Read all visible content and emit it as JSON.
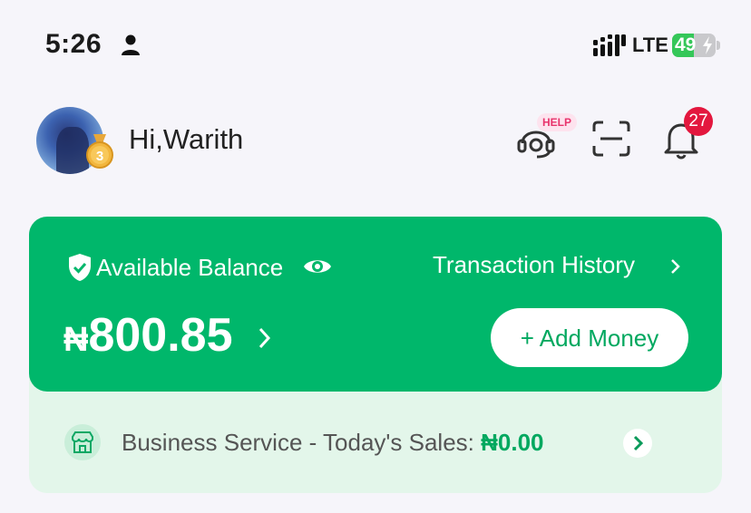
{
  "status_bar": {
    "time": "5:26",
    "network": "LTE",
    "battery": "49",
    "battery_level": 0.49,
    "icons": [
      "person-icon",
      "signal-icon",
      "battery-icon"
    ]
  },
  "header": {
    "greeting": "Hi,Warith",
    "medal_level": "3",
    "help_badge": "HELP",
    "notification_count": "27",
    "icons": [
      "headset-icon",
      "scan-icon",
      "bell-icon"
    ]
  },
  "balance_card": {
    "label": "Available Balance",
    "currency": "₦",
    "amount": "800.85",
    "transaction_history": "Transaction History",
    "add_money": "+ Add Money",
    "color": "#00b76b"
  },
  "business": {
    "label": "Business Service - Today's Sales: ",
    "amount": "₦0.00"
  },
  "colors": {
    "primary_green": "#00b76b",
    "badge_red": "#e3173e",
    "help_pink": "#e8346c",
    "light_green": "#e3f6ea"
  }
}
